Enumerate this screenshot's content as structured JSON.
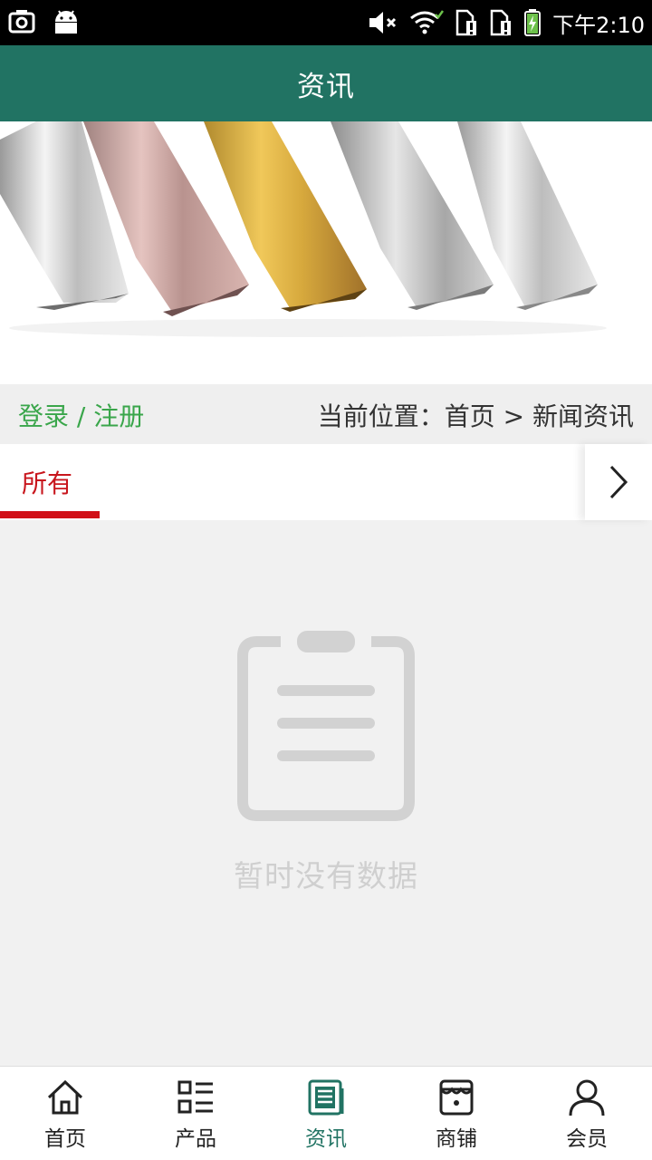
{
  "status_bar": {
    "time": "下午2:10",
    "icons": [
      "screenshot-icon",
      "android-icon",
      "mute-icon",
      "wifi-icon",
      "sim-alert-icon",
      "sim-alert-icon",
      "battery-charging-icon"
    ]
  },
  "header": {
    "title": "资讯"
  },
  "login": {
    "login_label": "登录",
    "separator": " / ",
    "register_label": "注册"
  },
  "breadcrumb": {
    "text": "当前位置：首页 > 新闻资讯"
  },
  "tabs": {
    "items": [
      {
        "label": "所有",
        "active": true
      }
    ],
    "more_icon": "chevron-right-icon"
  },
  "empty_state": {
    "icon": "clipboard-icon",
    "message": "暂时没有数据"
  },
  "bottom_nav": {
    "items": [
      {
        "label": "首页",
        "icon": "home-icon"
      },
      {
        "label": "产品",
        "icon": "list-icon"
      },
      {
        "label": "资讯",
        "icon": "news-icon",
        "active": true
      },
      {
        "label": "商铺",
        "icon": "shop-icon"
      },
      {
        "label": "会员",
        "icon": "user-icon"
      }
    ]
  },
  "colors": {
    "header_bg": "#217363",
    "active_tab": "#c8161d",
    "login_link": "#3aa64b",
    "nav_active": "#217363"
  }
}
